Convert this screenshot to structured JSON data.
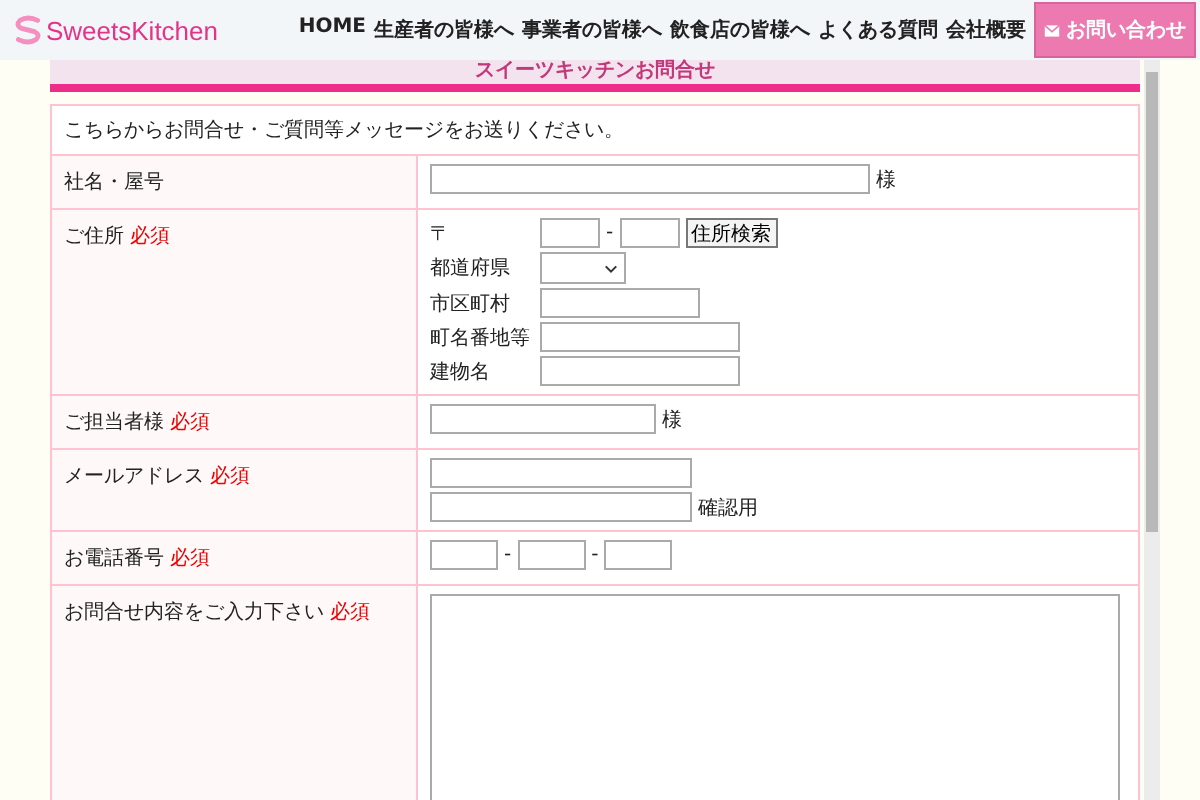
{
  "header": {
    "logo": "SweetsKitchen",
    "nav": [
      {
        "label": "HOME"
      },
      {
        "label": "生産者の皆様へ"
      },
      {
        "label": "事業者の皆様へ"
      },
      {
        "label": "飲食店の皆様へ"
      },
      {
        "label": "よくある質問"
      },
      {
        "label": "会社概要"
      }
    ],
    "contact_button": "お問い合わせ"
  },
  "banner": {
    "title": "スイーツキッチンお問合せ"
  },
  "form": {
    "intro": "こちらからお問合せ・ご質問等メッセージをお送りください。",
    "rows": [
      {
        "kind": "text",
        "label": "社名・屋号",
        "suffix": "様"
      },
      {
        "kind": "address",
        "label": "ご住所",
        "badge": "必須",
        "fields": [
          {
            "kind": "postal",
            "label": "〒",
            "separator": "-",
            "button": "住所検索"
          },
          {
            "kind": "select",
            "label": "都道府県"
          },
          {
            "kind": "short-text",
            "label": "市区町村"
          },
          {
            "kind": "text",
            "label": "町名番地等"
          },
          {
            "kind": "text",
            "label": "建物名"
          }
        ]
      },
      {
        "kind": "text",
        "label": "ご担当者様",
        "badge": "必須",
        "suffix": "様"
      },
      {
        "kind": "email",
        "label": "メールアドレス",
        "badge": "必須",
        "confirm_label": "確認用"
      },
      {
        "kind": "phone",
        "label": "お電話番号",
        "badge": "必須",
        "separators": [
          "-",
          "-"
        ]
      },
      {
        "kind": "textarea",
        "label": "お問合せ内容をご入力下さい",
        "badge": "必須"
      }
    ]
  }
}
